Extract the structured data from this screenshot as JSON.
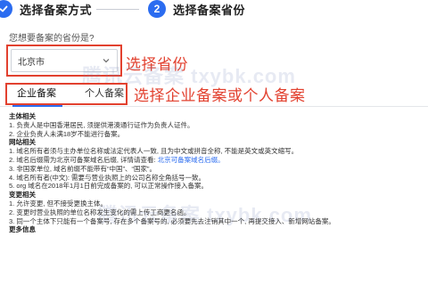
{
  "stepper": {
    "steps": [
      {
        "number": "✓",
        "label": "选择备案方式",
        "state": "done"
      },
      {
        "number": "2",
        "label": "选择备案省份",
        "state": "active"
      }
    ]
  },
  "province": {
    "question": "您想要备案的省份是?",
    "selected": "北京市"
  },
  "annotations": {
    "province": "选择省份",
    "type": "选择企业备案或个人备案"
  },
  "tabs": [
    {
      "label": "企业备案",
      "active": true
    },
    {
      "label": "个人备案",
      "active": false
    }
  ],
  "watermark": "腾讯云备案 txybk.com",
  "sections": [
    {
      "title": "主体相关",
      "rules": [
        {
          "text": "1. 负责人是中国香港居民, 须提供港澳通行证作为负责人证件。"
        },
        {
          "text": "2. 企业负责人未满18岁不能进行备案。"
        }
      ]
    },
    {
      "title": "网站相关",
      "rules": [
        {
          "text": "1. 域名所有者须与主办单位名称或法定代表人一致, 且为中文或拼音全称, 不能是英文或英文缩写。"
        },
        {
          "text": "2. 域名后缀需为北京可备案域名后缀, 详情请查看: ",
          "link": "北京可备案域名后缀。"
        },
        {
          "text": "3. 非国家单位, 域名前缀不能带有“中国”、“国家”。"
        },
        {
          "text": "4. 域名所有者(中文): 需要与营业执照上的公司名称全角括号一致。"
        },
        {
          "text": "5. org 域名在2018年1月1日前完成备案的, 可以正常操作接入备案。"
        }
      ]
    },
    {
      "title": "变更相关",
      "rules": [
        {
          "text": "1. 允许变更, 但不接受更换主体。"
        },
        {
          "text": "2. 变更时营业执照的单位名称发生变化的需上传工商更名函。"
        },
        {
          "text": "3. 同一个主体下只能有一个备案号, 存在多个备案号的, 必须要先去注销其中一个, 再提交接入、新增网站备案。"
        }
      ]
    },
    {
      "title": "更多信息",
      "rules": []
    }
  ],
  "colors": {
    "accent": "#2b6cf0",
    "annotation": "#e2412f"
  }
}
